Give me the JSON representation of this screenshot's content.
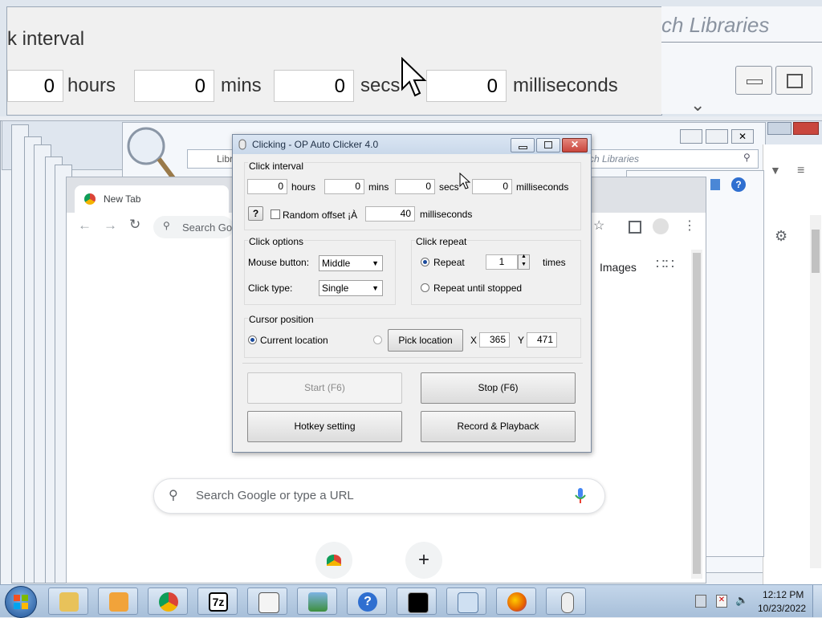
{
  "zoom": {
    "interval_label": "k interval",
    "hours_value": "0",
    "hours_label": "hours",
    "mins_value": "0",
    "mins_label": "mins",
    "secs_value": "0",
    "secs_label": "secs",
    "ms_value": "0",
    "ms_label": "milliseconds",
    "libraries_text": "ch Libraries"
  },
  "explorer": {
    "address_text": "Libr",
    "search_text": "ch Libraries"
  },
  "chrome": {
    "tab_title": "New Tab",
    "omnibox_placeholder": "Search Go",
    "images_link": "Images",
    "search_placeholder": "Search Google or type a URL",
    "add_shortcut": "+"
  },
  "autoclicker": {
    "title": "Clicking - OP Auto Clicker 4.0",
    "click_interval": {
      "label": "Click interval",
      "hours": "0",
      "hours_label": "hours",
      "mins": "0",
      "mins_label": "mins",
      "secs": "0",
      "secs_label": "secs",
      "ms": "0",
      "ms_label": "milliseconds",
      "help": "?",
      "random_offset_label": "Random offset ¡À",
      "random_offset_value": "40",
      "random_offset_unit": "milliseconds"
    },
    "click_options": {
      "label": "Click options",
      "mouse_button_label": "Mouse button:",
      "mouse_button_value": "Middle",
      "click_type_label": "Click type:",
      "click_type_value": "Single"
    },
    "click_repeat": {
      "label": "Click repeat",
      "repeat_label": "Repeat",
      "repeat_value": "1",
      "times_label": "times",
      "until_stopped_label": "Repeat until stopped"
    },
    "cursor_position": {
      "label": "Cursor position",
      "current_location": "Current location",
      "pick_location": "Pick location",
      "x_label": "X",
      "x_value": "365",
      "y_label": "Y",
      "y_value": "471"
    },
    "buttons": {
      "start": "Start (F6)",
      "stop": "Stop (F6)",
      "hotkey": "Hotkey setting",
      "record": "Record & Playback"
    }
  },
  "taskbar": {
    "clock_time": "12:12 PM",
    "clock_date": "10/23/2022",
    "sevenzip_label": "7z",
    "help_label": "?"
  },
  "colors": {
    "taskbar": "#a7bfd9",
    "dialog_bg": "#f0f0f0",
    "titlebar": "#c9d8ea",
    "close_button": "#c9463d"
  }
}
